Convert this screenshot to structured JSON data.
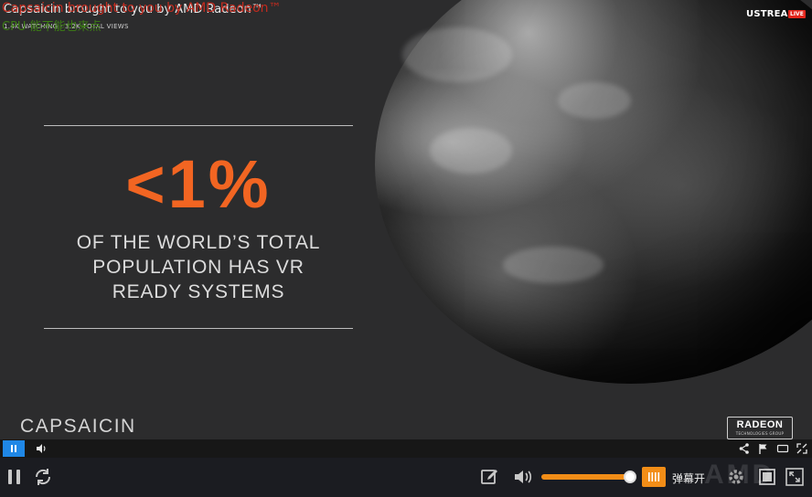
{
  "stream": {
    "title": "Capsaicin brought to you by AMD Radeon™",
    "meta": "1.4K WATCHING  ·  3.2K TOTAL VIEWS",
    "platform": "USTREAM",
    "live_badge": "LIVE"
  },
  "danmaku": {
    "line_1": "Capsaicin brought to you by AMD Radeon™",
    "line_2": "CPU 能不能也来点"
  },
  "slide": {
    "stat": "<1%",
    "desc_line_1": "OF THE WORLD’S TOTAL",
    "desc_line_2": "POPULATION HAS VR",
    "desc_line_3": "READY SYSTEMS",
    "event_logo": "CAPSAICIN",
    "brand_logo": "RADEON",
    "brand_sub": "TECHNOLOGIES GROUP"
  },
  "player_bar": {
    "danmu_label": "弹幕开",
    "volume_level": 1.0,
    "watermark": "AMD"
  },
  "icons": {
    "inner_pause": "pause-icon",
    "inner_volume": "volume-icon",
    "inner_share": "share-icon",
    "inner_flag": "flag-icon",
    "inner_cc": "captions-icon",
    "inner_fullscreen": "fullscreen-icon",
    "outer_pause": "pause-icon",
    "outer_refresh": "refresh-icon",
    "outer_edit": "edit-icon",
    "outer_volume": "volume-icon",
    "outer_danmu": "danmu-icon",
    "outer_settings": "gear-icon",
    "outer_pip": "pip-icon",
    "outer_fullscreen": "fullscreen-icon"
  },
  "colors": {
    "accent_orange": "#f26522",
    "volume_orange": "#f28d17",
    "inner_play_blue": "#1f87e6",
    "live_red": "#e3261c"
  }
}
